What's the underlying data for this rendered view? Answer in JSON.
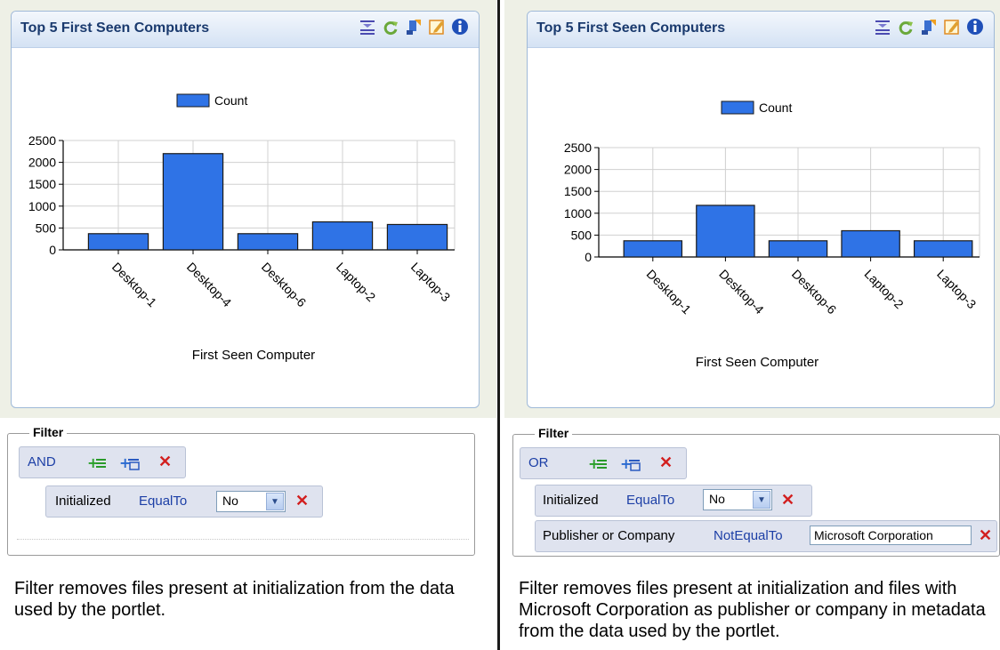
{
  "left": {
    "portlet_title": "Top 5 First Seen Computers",
    "filter": {
      "legend": "Filter",
      "operator": "AND",
      "conditions": [
        {
          "field": "Initialized",
          "op": "EqualTo",
          "value": "No",
          "type": "select"
        }
      ]
    },
    "caption": "Filter removes files present at initialization from the data used by the portlet.",
    "chart_data": {
      "type": "bar",
      "categories": [
        "Desktop-1",
        "Desktop-4",
        "Desktop-6",
        "Laptop-2",
        "Laptop-3"
      ],
      "series": [
        {
          "name": "Count",
          "values": [
            370,
            2200,
            370,
            640,
            580
          ]
        }
      ],
      "xlabel": "First Seen Computer",
      "ylim": [
        0,
        2500
      ],
      "yticks": [
        0,
        500,
        1000,
        1500,
        2000,
        2500
      ],
      "legend": "top-center",
      "grid": true,
      "bar_color": "#2f73e6"
    }
  },
  "right": {
    "portlet_title": "Top 5 First Seen Computers",
    "filter": {
      "legend": "Filter",
      "operator": "OR",
      "conditions": [
        {
          "field": "Initialized",
          "op": "EqualTo",
          "value": "No",
          "type": "select"
        },
        {
          "field": "Publisher or Company",
          "op": "NotEqualTo",
          "value": "Microsoft Corporation",
          "type": "text"
        }
      ]
    },
    "caption": "Filter removes files present at initialization and files with Microsoft Corporation as publisher or company in metadata from the data used by the portlet.",
    "chart_data": {
      "type": "bar",
      "categories": [
        "Desktop-1",
        "Desktop-4",
        "Desktop-6",
        "Laptop-2",
        "Laptop-3"
      ],
      "series": [
        {
          "name": "Count",
          "values": [
            370,
            1180,
            370,
            600,
            370
          ]
        }
      ],
      "xlabel": "First Seen Computer",
      "ylim": [
        0,
        2500
      ],
      "yticks": [
        0,
        500,
        1000,
        1500,
        2000,
        2500
      ],
      "legend": "top-center",
      "grid": true,
      "bar_color": "#2f73e6"
    }
  },
  "icons": [
    "collapse-icon",
    "refresh-icon",
    "export-icon",
    "edit-icon",
    "info-icon",
    "add-condition-icon",
    "add-group-icon",
    "remove-icon",
    "dropdown-arrow-icon"
  ]
}
